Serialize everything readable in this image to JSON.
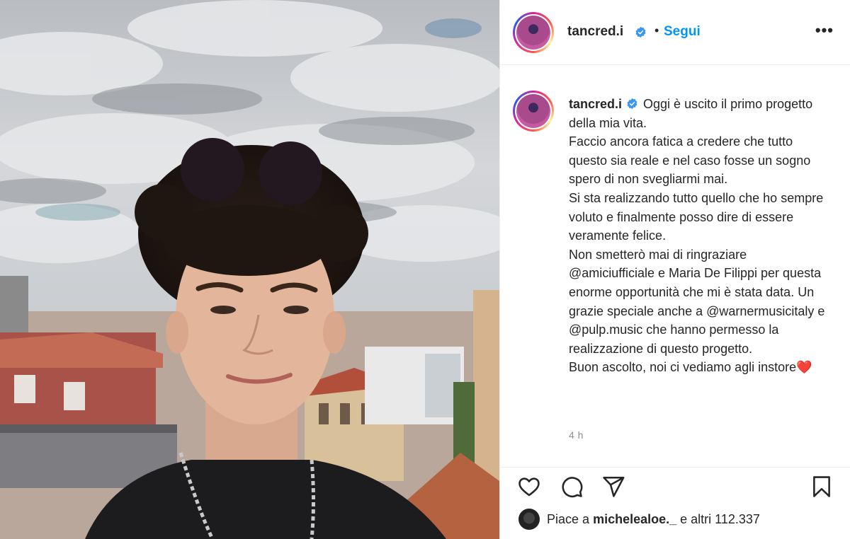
{
  "post": {
    "username": "tancred.i",
    "follow_label": "Segui",
    "separator": "•",
    "more_label": "•••",
    "caption": {
      "username": "tancred.i",
      "lines": [
        "Oggi è uscito il primo progetto della mia vita.",
        "Faccio ancora fatica a credere che tutto questo sia reale e nel caso fosse un sogno spero di non svegliarmi mai.",
        "Si sta realizzando tutto quello che ho sempre voluto e finalmente posso dire di essere veramente felice.",
        "Non smetterò mai di ringraziare @amiciufficiale e Maria De Filippi per questa enorme opportunità che mi è stata data. Un grazie speciale anche a @warnermusicitaly e @pulp.music che hanno permesso la realizzazione di questo progetto.",
        "Buon ascolto, noi ci vediamo agli instore"
      ],
      "emoji": "❤️"
    },
    "timestamp": "4 h",
    "likes": {
      "prefix": "Piace a",
      "liker": "michelealoe._",
      "suffix": "e altri 112.337"
    }
  },
  "icons": {
    "like": "heart-icon",
    "comment": "comment-icon",
    "share": "share-icon",
    "save": "bookmark-icon",
    "verified": "verified-badge-icon"
  },
  "colors": {
    "accent": "#0095f6",
    "verified": "#3897f0",
    "text": "#262626",
    "muted": "#8e8e8e"
  }
}
